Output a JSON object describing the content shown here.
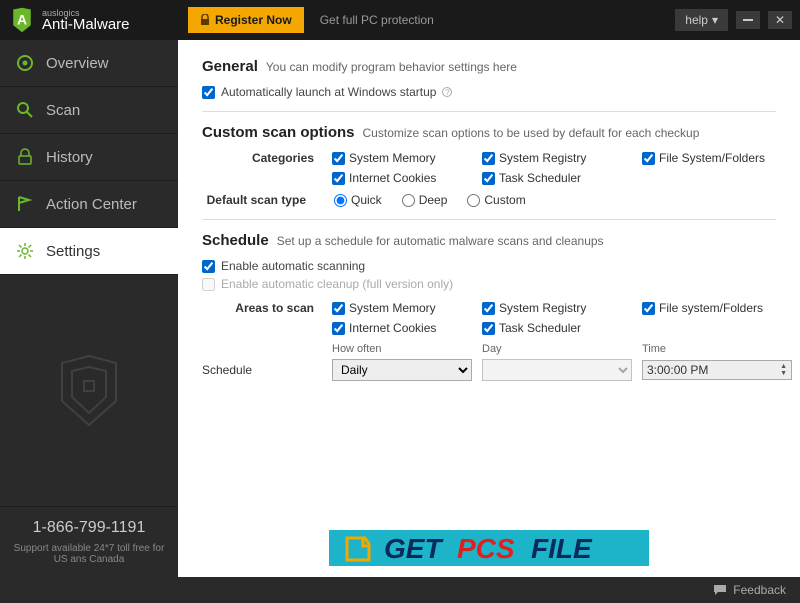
{
  "titlebar": {
    "brand": "auslogics",
    "product": "Anti-Malware",
    "register": "Register Now",
    "protection": "Get full PC protection",
    "help": "help"
  },
  "sidebar": {
    "items": {
      "overview": "Overview",
      "scan": "Scan",
      "history": "History",
      "action": "Action Center",
      "settings": "Settings"
    },
    "phone": "1-866-799-1191",
    "support": "Support available 24*7 toll free for US ans Canada"
  },
  "general": {
    "title": "General",
    "sub": "You can modify program behavior settings here",
    "autolaunch": "Automatically launch at Windows startup"
  },
  "custom": {
    "title": "Custom scan options",
    "sub": "Customize scan options to be used by default for each checkup",
    "categories_label": "Categories",
    "c1": "System Memory",
    "c2": "System Registry",
    "c3": "File System/Folders",
    "c4": "Internet Cookies",
    "c5": "Task Scheduler",
    "scantype_label": "Default scan type",
    "r1": "Quick",
    "r2": "Deep",
    "r3": "Custom"
  },
  "schedule": {
    "title": "Schedule",
    "sub": "Set up a schedule for automatic malware scans and cleanups",
    "enable": "Enable automatic scanning",
    "cleanup": "Enable automatic cleanup (full version only)",
    "areas_label": "Areas to scan",
    "a1": "System Memory",
    "a2": "System Registry",
    "a3": "File system/Folders",
    "a4": "Internet Cookies",
    "a5": "Task Scheduler",
    "sched_label": "Schedule",
    "howoften_hdr": "How often",
    "day_hdr": "Day",
    "time_hdr": "Time",
    "howoften_val": "Daily",
    "time_val": "3:00:00 PM"
  },
  "statusbar": {
    "feedback": "Feedback"
  },
  "watermark": {
    "text1": "GET",
    "text2": "PCS",
    "text3": "FILE"
  }
}
